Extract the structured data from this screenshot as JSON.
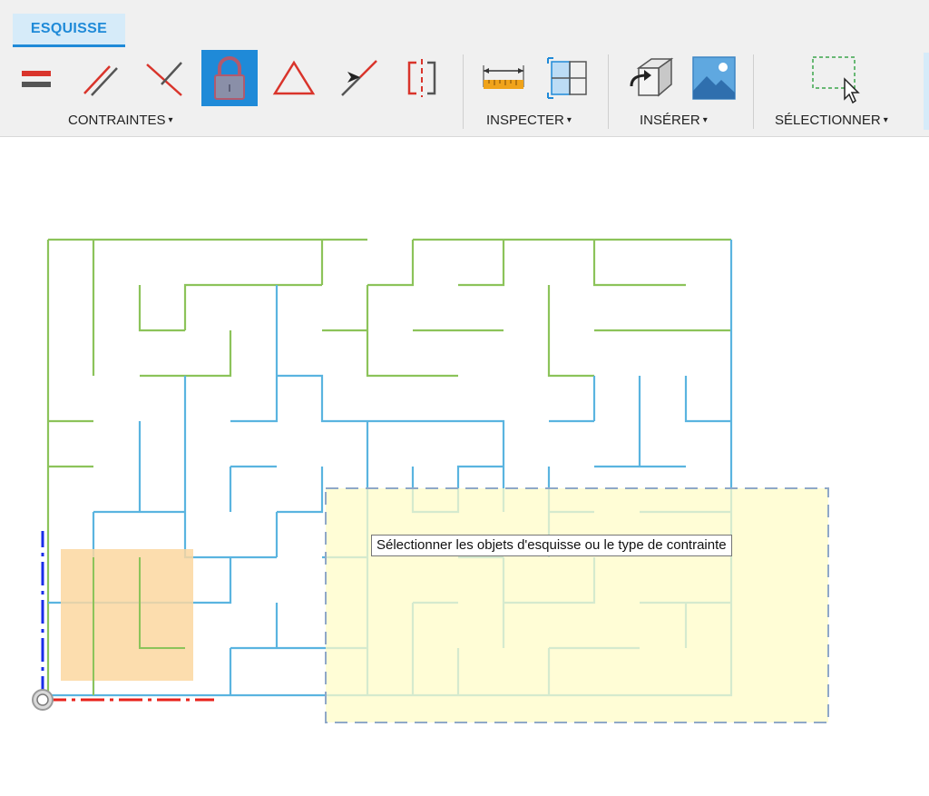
{
  "ribbon": {
    "active_tab": "ESQUISSE",
    "groups": {
      "constraints": "CONTRAINTES",
      "inspect": "INSPECTER",
      "insert": "INSÉRER",
      "select": "SÉLECTIONNER"
    },
    "caret": "▾"
  },
  "tooltip": {
    "text": "Sélectionner les objets d'esquisse ou le type de contrainte"
  },
  "colors": {
    "accent": "#1f8ad8",
    "maze_green": "#8cc35a",
    "maze_blue": "#5ab4e0",
    "selection_fill": "#fffcc8",
    "origin_highlight": "#fcd7a0",
    "axis_x": "#e8221b",
    "axis_y": "#1a2ee8"
  }
}
